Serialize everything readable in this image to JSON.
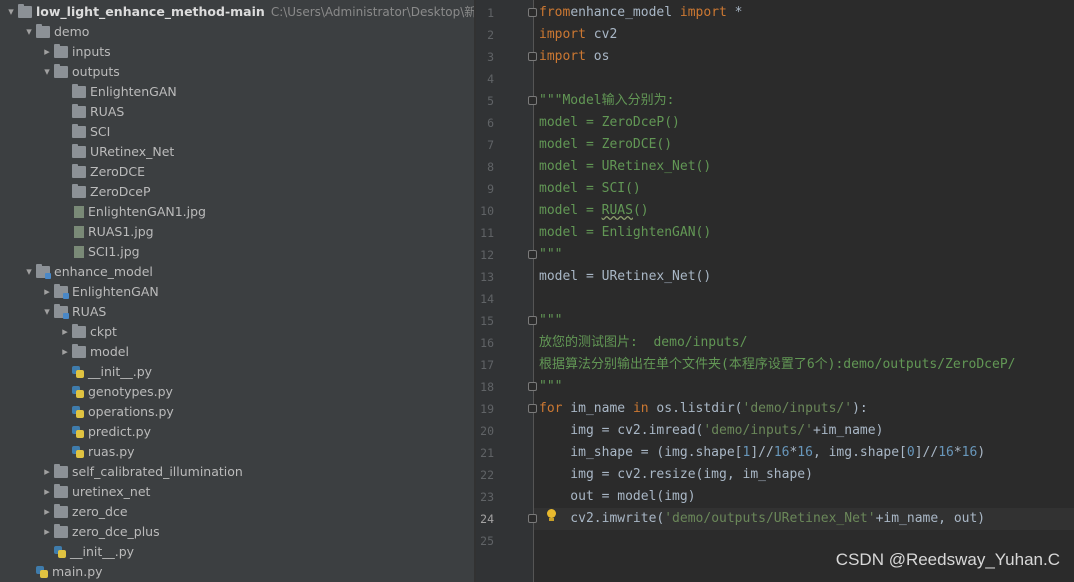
{
  "project": {
    "name": "low_light_enhance_method-main",
    "path": "C:\\Users\\Administrator\\Desktop\\新建文"
  },
  "tree": [
    {
      "label": "demo",
      "arrow": "▾",
      "icon": "folder"
    },
    {
      "label": "inputs",
      "arrow": "▸",
      "icon": "folder"
    },
    {
      "label": "outputs",
      "arrow": "▾",
      "icon": "folder"
    },
    {
      "label": "EnlightenGAN",
      "arrow": "",
      "icon": "folder"
    },
    {
      "label": "RUAS",
      "arrow": "",
      "icon": "folder"
    },
    {
      "label": "SCI",
      "arrow": "",
      "icon": "folder"
    },
    {
      "label": "URetinex_Net",
      "arrow": "",
      "icon": "folder"
    },
    {
      "label": "ZeroDCE",
      "arrow": "",
      "icon": "folder"
    },
    {
      "label": "ZeroDceP",
      "arrow": "",
      "icon": "folder"
    },
    {
      "label": "EnlightenGAN1.jpg",
      "arrow": "",
      "icon": "image"
    },
    {
      "label": "RUAS1.jpg",
      "arrow": "",
      "icon": "image"
    },
    {
      "label": "SCI1.jpg",
      "arrow": "",
      "icon": "image"
    },
    {
      "label": "enhance_model",
      "arrow": "▾",
      "icon": "module"
    },
    {
      "label": "EnlightenGAN",
      "arrow": "▸",
      "icon": "module"
    },
    {
      "label": "RUAS",
      "arrow": "▾",
      "icon": "module"
    },
    {
      "label": "ckpt",
      "arrow": "▸",
      "icon": "folder"
    },
    {
      "label": "model",
      "arrow": "▸",
      "icon": "folder"
    },
    {
      "label": "__init__.py",
      "arrow": "",
      "icon": "python"
    },
    {
      "label": "genotypes.py",
      "arrow": "",
      "icon": "python"
    },
    {
      "label": "operations.py",
      "arrow": "",
      "icon": "python"
    },
    {
      "label": "predict.py",
      "arrow": "",
      "icon": "python"
    },
    {
      "label": "ruas.py",
      "arrow": "",
      "icon": "python"
    },
    {
      "label": "self_calibrated_illumination",
      "arrow": "▸",
      "icon": "folder"
    },
    {
      "label": "uretinex_net",
      "arrow": "▸",
      "icon": "folder"
    },
    {
      "label": "zero_dce",
      "arrow": "▸",
      "icon": "folder"
    },
    {
      "label": "zero_dce_plus",
      "arrow": "▸",
      "icon": "folder"
    },
    {
      "label": "__init__.py",
      "arrow": "",
      "icon": "python"
    },
    {
      "label": "main.py",
      "arrow": "",
      "icon": "python"
    }
  ],
  "editor": {
    "line_numbers": [
      "1",
      "2",
      "3",
      "4",
      "5",
      "6",
      "7",
      "8",
      "9",
      "10",
      "11",
      "12",
      "13",
      "14",
      "15",
      "16",
      "17",
      "18",
      "19",
      "20",
      "21",
      "22",
      "23",
      "24",
      "25"
    ],
    "current_line": "24",
    "lines": [
      [
        [
          "kw",
          "from"
        ],
        [
          "",
          "enhance_model "
        ],
        [
          "kw",
          "import"
        ],
        [
          "",
          " *"
        ]
      ],
      [
        [
          "kw",
          "import"
        ],
        [
          "",
          " cv2"
        ]
      ],
      [
        [
          "kw",
          "import"
        ],
        [
          "",
          " os"
        ]
      ],
      [],
      [
        [
          "cm",
          "\"\"\"Model输入分别为:"
        ]
      ],
      [
        [
          "cm",
          "model = ZeroDceP()"
        ]
      ],
      [
        [
          "cm",
          "model = ZeroDCE()"
        ]
      ],
      [
        [
          "cm",
          "model = URetinex_Net()"
        ]
      ],
      [
        [
          "cm",
          "model = SCI()"
        ]
      ],
      [
        [
          "cm",
          "model = "
        ],
        [
          "cm ul",
          "RUAS"
        ],
        [
          "cm",
          "()"
        ]
      ],
      [
        [
          "cm",
          "model = EnlightenGAN()"
        ]
      ],
      [
        [
          "cm",
          "\"\"\""
        ]
      ],
      [
        [
          "",
          "model = URetinex_Net()"
        ]
      ],
      [],
      [
        [
          "cm",
          "\"\"\""
        ]
      ],
      [
        [
          "cm",
          "放您的测试图片:  demo/inputs/"
        ]
      ],
      [
        [
          "cm",
          "根据算法分别输出在单个文件夹(本程序设置了6个):demo/outputs/ZeroDceP/"
        ]
      ],
      [
        [
          "cm",
          "\"\"\""
        ]
      ],
      [
        [
          "kw",
          "for"
        ],
        [
          "",
          " im_name "
        ],
        [
          "kw",
          "in"
        ],
        [
          "",
          " os.listdir("
        ],
        [
          "str",
          "'demo/inputs/'"
        ],
        [
          "",
          "):"
        ]
      ],
      [
        [
          "",
          "    img = cv2.imread("
        ],
        [
          "str",
          "'demo/inputs/'"
        ],
        [
          "",
          "+im_name)"
        ]
      ],
      [
        [
          "",
          "    im_shape = (img.shape["
        ],
        [
          "num",
          "1"
        ],
        [
          "",
          "]//"
        ],
        [
          "num",
          "16"
        ],
        [
          "",
          "*"
        ],
        [
          "num",
          "16"
        ],
        [
          "",
          ", img.shape["
        ],
        [
          "num",
          "0"
        ],
        [
          "",
          "]//"
        ],
        [
          "num",
          "16"
        ],
        [
          "",
          "*"
        ],
        [
          "num",
          "16"
        ],
        [
          "",
          ")"
        ]
      ],
      [
        [
          "",
          "    img = cv2.resize(img, im_shape)"
        ]
      ],
      [
        [
          "",
          "    out = model(img)"
        ]
      ],
      [
        [
          "",
          "    cv2.imwrite("
        ],
        [
          "str",
          "'demo/outputs/URetinex_Net'"
        ],
        [
          "",
          "+im_name, out)"
        ]
      ],
      []
    ]
  },
  "watermark": "CSDN @Reedsway_Yuhan.C"
}
